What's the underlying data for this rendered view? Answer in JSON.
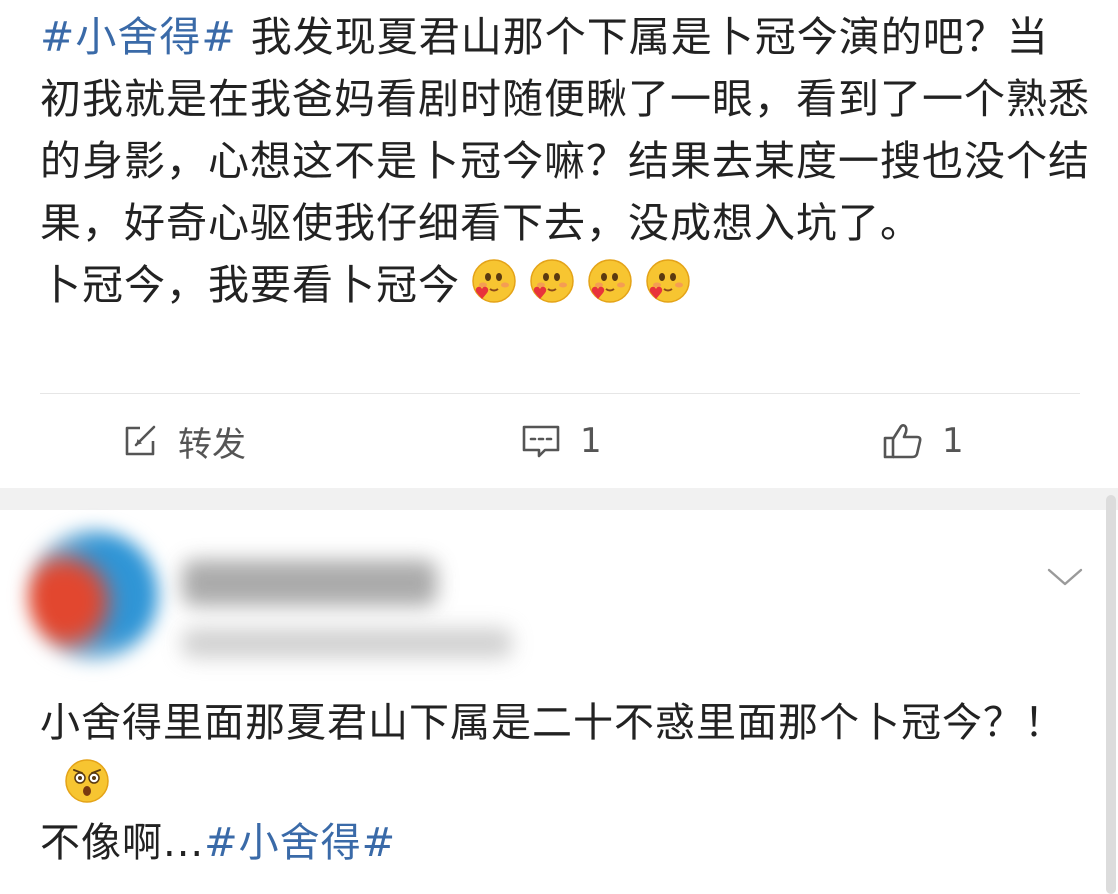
{
  "post": {
    "hashtag": "#小舍得#",
    "text_main": " 我发现夏君山那个下属是卜冠今演的吧？当初我就是在我爸妈看剧时随便瞅了一眼，看到了一个熟悉的身影，心想这不是卜冠今嘛？结果去某度一搜也没个结果，好奇心驱使我仔细看下去，没成想入坑了。",
    "text_line2": "卜冠今，我要看卜冠今",
    "emojis": [
      "heart-kiss-emoji",
      "heart-kiss-emoji",
      "heart-kiss-emoji",
      "heart-kiss-emoji"
    ]
  },
  "actions": {
    "repost_label": "转发",
    "comment_count": "1",
    "like_count": "1",
    "icons": {
      "repost": "repost-icon",
      "comment": "comment-icon",
      "like": "thumbs-up-icon"
    }
  },
  "comment": {
    "line1": "小舍得里面那夏君山下属是二十不惑里面那个卜冠今？！",
    "emoji": "surprised-emoji",
    "line2_prefix": "不像啊...",
    "hashtag": "#小舍得#",
    "chevron_icon": "chevron-down-icon"
  },
  "colors": {
    "hashtag": "#3a6aa8",
    "text": "#222222",
    "icon": "#555555",
    "separator": "#f1f1f1"
  }
}
